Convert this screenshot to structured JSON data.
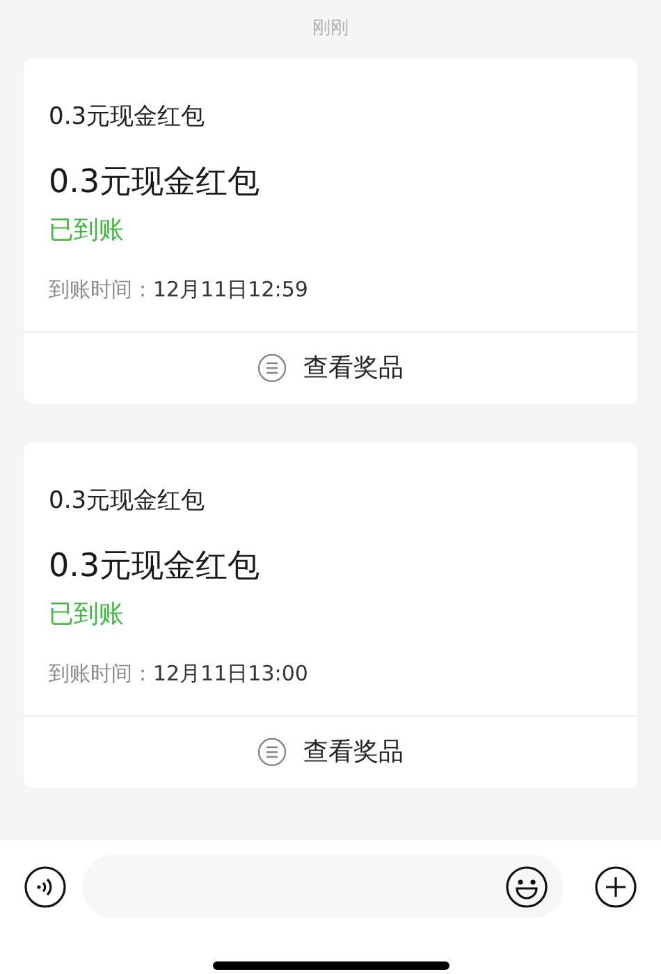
{
  "timestamp": "刚刚",
  "cards": [
    {
      "title": "0.3元现金红包",
      "heading": "0.3元现金红包",
      "status": "已到账",
      "time_label": "到账时间：",
      "time_value": "12月11日12:59",
      "action": "查看奖品"
    },
    {
      "title": "0.3元现金红包",
      "heading": "0.3元现金红包",
      "status": "已到账",
      "time_label": "到账时间：",
      "time_value": "12月11日13:00",
      "action": "查看奖品"
    }
  ]
}
